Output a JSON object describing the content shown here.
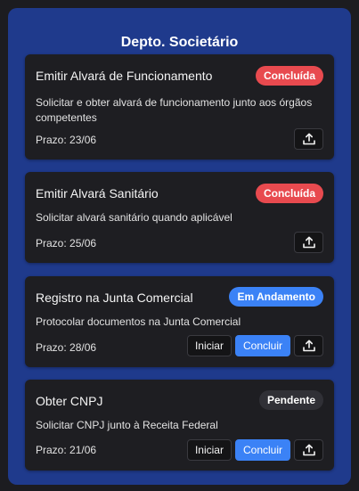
{
  "panel": {
    "title": "Depto. Societário"
  },
  "colors": {
    "panel_bg": "#1f3a8c",
    "card_bg": "#1e1e22",
    "status_done": "#e84a4f",
    "status_in_progress": "#3b82f6",
    "status_pending": "#303036",
    "primary_button": "#3b82f6"
  },
  "tasks": [
    {
      "title": "Emitir Alvará de Funcionamento",
      "status": "Concluída",
      "description": "Solicitar e obter alvará de funcionamento junto aos órgãos competentes",
      "deadline": "Prazo: 23/06",
      "upload_icon": "upload-icon"
    },
    {
      "title": "Emitir Alvará Sanitário",
      "status": "Concluída",
      "description": "Solicitar alvará sanitário quando aplicável",
      "deadline": "Prazo: 25/06",
      "upload_icon": "upload-icon"
    },
    {
      "title": "Registro na Junta Comercial",
      "status": "Em Andamento",
      "description": "Protocolar documentos na Junta Comercial",
      "deadline": "Prazo: 28/06",
      "start_label": "Iniciar",
      "complete_label": "Concluir",
      "upload_icon": "upload-icon"
    },
    {
      "title": "Obter CNPJ",
      "status": "Pendente",
      "description": "Solicitar CNPJ junto à Receita Federal",
      "deadline": "Prazo: 21/06",
      "start_label": "Iniciar",
      "complete_label": "Concluir",
      "upload_icon": "upload-icon"
    }
  ]
}
